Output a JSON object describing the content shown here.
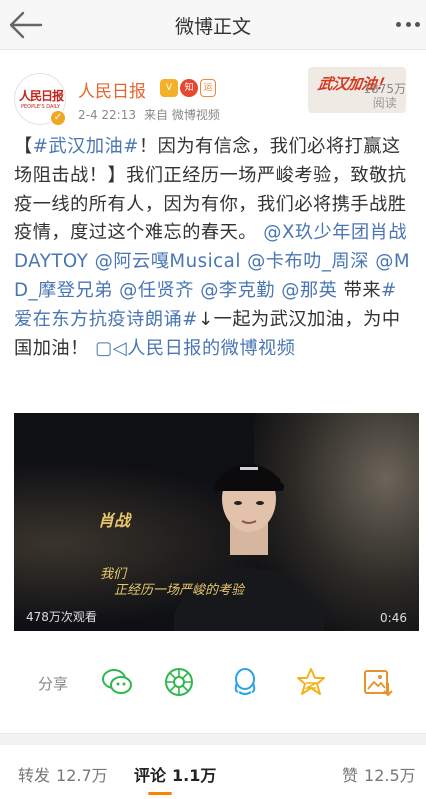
{
  "header": {
    "title": "微博正文",
    "back_icon": "back-arrow-icon",
    "more_icon": "more-dots-icon"
  },
  "author": {
    "name": "人民日报",
    "avatar_text": "人民日报",
    "avatar_subtext": "PEOPLE'S DAILY",
    "time": "2-4 22:13",
    "source": "来自 微博视频",
    "badge_vip": "V",
    "badge_hot": "知",
    "badge_yun": "运",
    "card_text": "武汉加油！",
    "reads_count": "1875万",
    "reads_label": "阅读"
  },
  "post": {
    "p1": "【",
    "topic1": "#武汉加油#",
    "p2": "！因为有信念，我们必将打赢这场阻击战！】我们正经历一场严峻考验，致敬抗疫一线的所有人，因为有你，我们必将携手战胜疫情，度过这个难忘的春天。",
    "m1": "@X玖少年团肖战DAYTOY",
    "m2": "@阿云嘎Musical",
    "m3": "@卡布叻_周深",
    "m4": "@MD_摩登兄弟",
    "m5": "@任贤齐",
    "m6": "@李克勤",
    "m7": "@那英",
    "p3": "带来",
    "topic2": "#爱在东方抗疫诗朗诵#",
    "p4": "↓一起为武汉加油，为中国加油！",
    "video_link": "人民日报的微博视频"
  },
  "video": {
    "name": "肖战",
    "line1": "我们",
    "line2": "正经历一场严峻的考验",
    "view_count": "478万次观看",
    "duration": "0:46"
  },
  "actions": {
    "share_label": "分享",
    "icons": [
      "wechat-icon",
      "moments-icon",
      "qq-icon",
      "qzone-icon",
      "save-image-icon"
    ]
  },
  "tabs": {
    "repost_label": "转发",
    "repost_count": "12.7万",
    "comment_label": "评论",
    "comment_count": "1.1万",
    "like_label": "赞",
    "like_count": "12.5万",
    "accent": "#ff8200"
  }
}
